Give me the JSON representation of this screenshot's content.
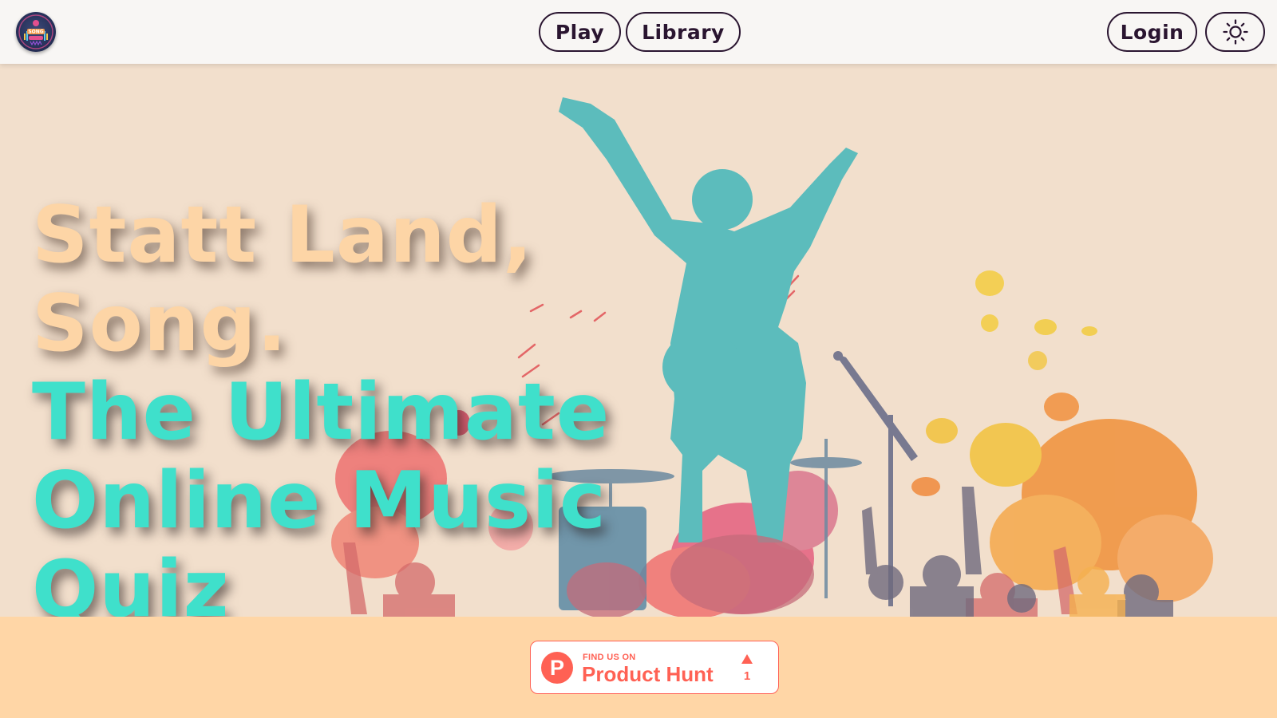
{
  "app": {
    "logo_icon": "song-quiz-logo-icon",
    "logo_text": "SONG"
  },
  "nav": {
    "play_label": "Play",
    "library_label": "Library",
    "login_label": "Login",
    "theme_icon": "sun-icon"
  },
  "hero": {
    "title_line_1": "Statt Land,",
    "title_line_2": "Song.",
    "subtitle_line_1": "The Ultimate",
    "subtitle_line_2": "Online Music",
    "subtitle_line_3": "Quiz"
  },
  "footer": {
    "product_hunt": {
      "logo_letter": "P",
      "eyebrow": "FIND US ON",
      "name": "Product Hunt",
      "upvote_icon": "triangle-up-icon",
      "upvotes": "1"
    }
  },
  "colors": {
    "background": "#f2dfcc",
    "navbar": "#f8f6f4",
    "nav_border": "#2a1530",
    "title_peach": "#fdd5a6",
    "subtitle_teal": "#3fe0cb",
    "footer": "#ffd6a6",
    "product_hunt": "#ff6154"
  }
}
